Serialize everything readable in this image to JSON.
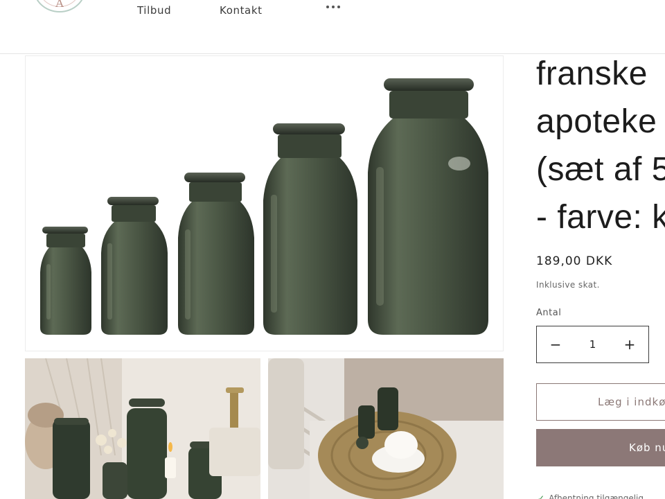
{
  "header": {
    "logo_letter": "A",
    "nav": [
      {
        "label": "Tilbud"
      },
      {
        "label": "Kontakt"
      }
    ],
    "more_icon": "ellipsis-icon"
  },
  "product": {
    "title_lines": [
      "franske",
      "apoteke",
      "(sæt af 5",
      "- farve: k"
    ],
    "price": "189,00 DKK",
    "tax_note": "Inklusive skat.",
    "quantity_label": "Antal",
    "quantity_value": "1",
    "minus_symbol": "−",
    "plus_symbol": "+",
    "add_to_cart_label": "Læg i indkø",
    "buy_now_label": "Køb nu",
    "pickup_text": "Afhentning tilgængelig"
  },
  "colors": {
    "accent": "#8c7877",
    "glass_dark": "#3f4a3b",
    "glass_mid": "#5b6754",
    "check": "#2f8a3c"
  }
}
